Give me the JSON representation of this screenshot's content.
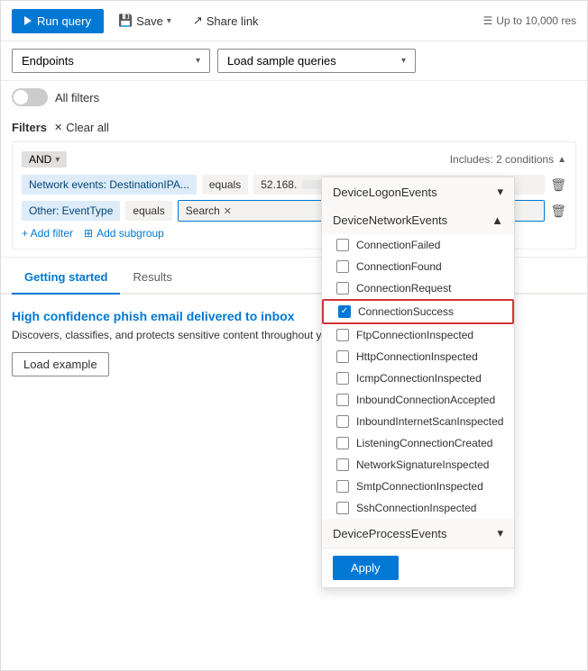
{
  "toolbar": {
    "run_query_label": "Run query",
    "save_label": "Save",
    "share_link_label": "Share link",
    "results_limit": "Up to 10,000 res"
  },
  "dropdowns": {
    "schema_label": "Endpoints",
    "sample_queries_label": "Load sample queries"
  },
  "all_filters": {
    "label": "All filters"
  },
  "filters": {
    "label": "Filters",
    "clear_all": "Clear all",
    "operator": "AND",
    "includes_label": "Includes: 2 conditions",
    "rows": [
      {
        "field": "Network events: DestinationIPA...",
        "operator": "equals",
        "value": "52.168.___",
        "is_ip": true
      },
      {
        "field": "Other: EventType",
        "operator": "equals",
        "value": "Search",
        "is_search": true
      }
    ],
    "add_filter": "+ Add filter",
    "add_subgroup": "Add subgroup"
  },
  "tabs": {
    "items": [
      {
        "label": "Getting started",
        "active": true
      },
      {
        "label": "Results",
        "active": false
      }
    ]
  },
  "content": {
    "card_title": "High confidence phish email delivered to inbox",
    "card_desc": "Discovers, classifies, and protects sensitive content throughout your organization.",
    "load_example_label": "Load example"
  },
  "event_type_dropdown": {
    "sections": [
      {
        "label": "DeviceLogonEvents",
        "expanded": false
      },
      {
        "label": "DeviceNetworkEvents",
        "expanded": true,
        "items": [
          {
            "label": "ConnectionFailed",
            "checked": false
          },
          {
            "label": "ConnectionFound",
            "checked": false
          },
          {
            "label": "ConnectionRequest",
            "checked": false
          },
          {
            "label": "ConnectionSuccess",
            "checked": true,
            "highlighted": true
          },
          {
            "label": "FtpConnectionInspected",
            "checked": false
          },
          {
            "label": "HttpConnectionInspected",
            "checked": false
          },
          {
            "label": "IcmpConnectionInspected",
            "checked": false
          },
          {
            "label": "InboundConnectionAccepted",
            "checked": false
          },
          {
            "label": "InboundInternetScanInspected",
            "checked": false
          },
          {
            "label": "ListeningConnectionCreated",
            "checked": false
          },
          {
            "label": "NetworkSignatureInspected",
            "checked": false
          },
          {
            "label": "SmtpConnectionInspected",
            "checked": false
          },
          {
            "label": "SshConnectionInspected",
            "checked": false
          }
        ]
      },
      {
        "label": "DeviceProcessEvents",
        "expanded": false
      }
    ],
    "apply_label": "Apply"
  }
}
